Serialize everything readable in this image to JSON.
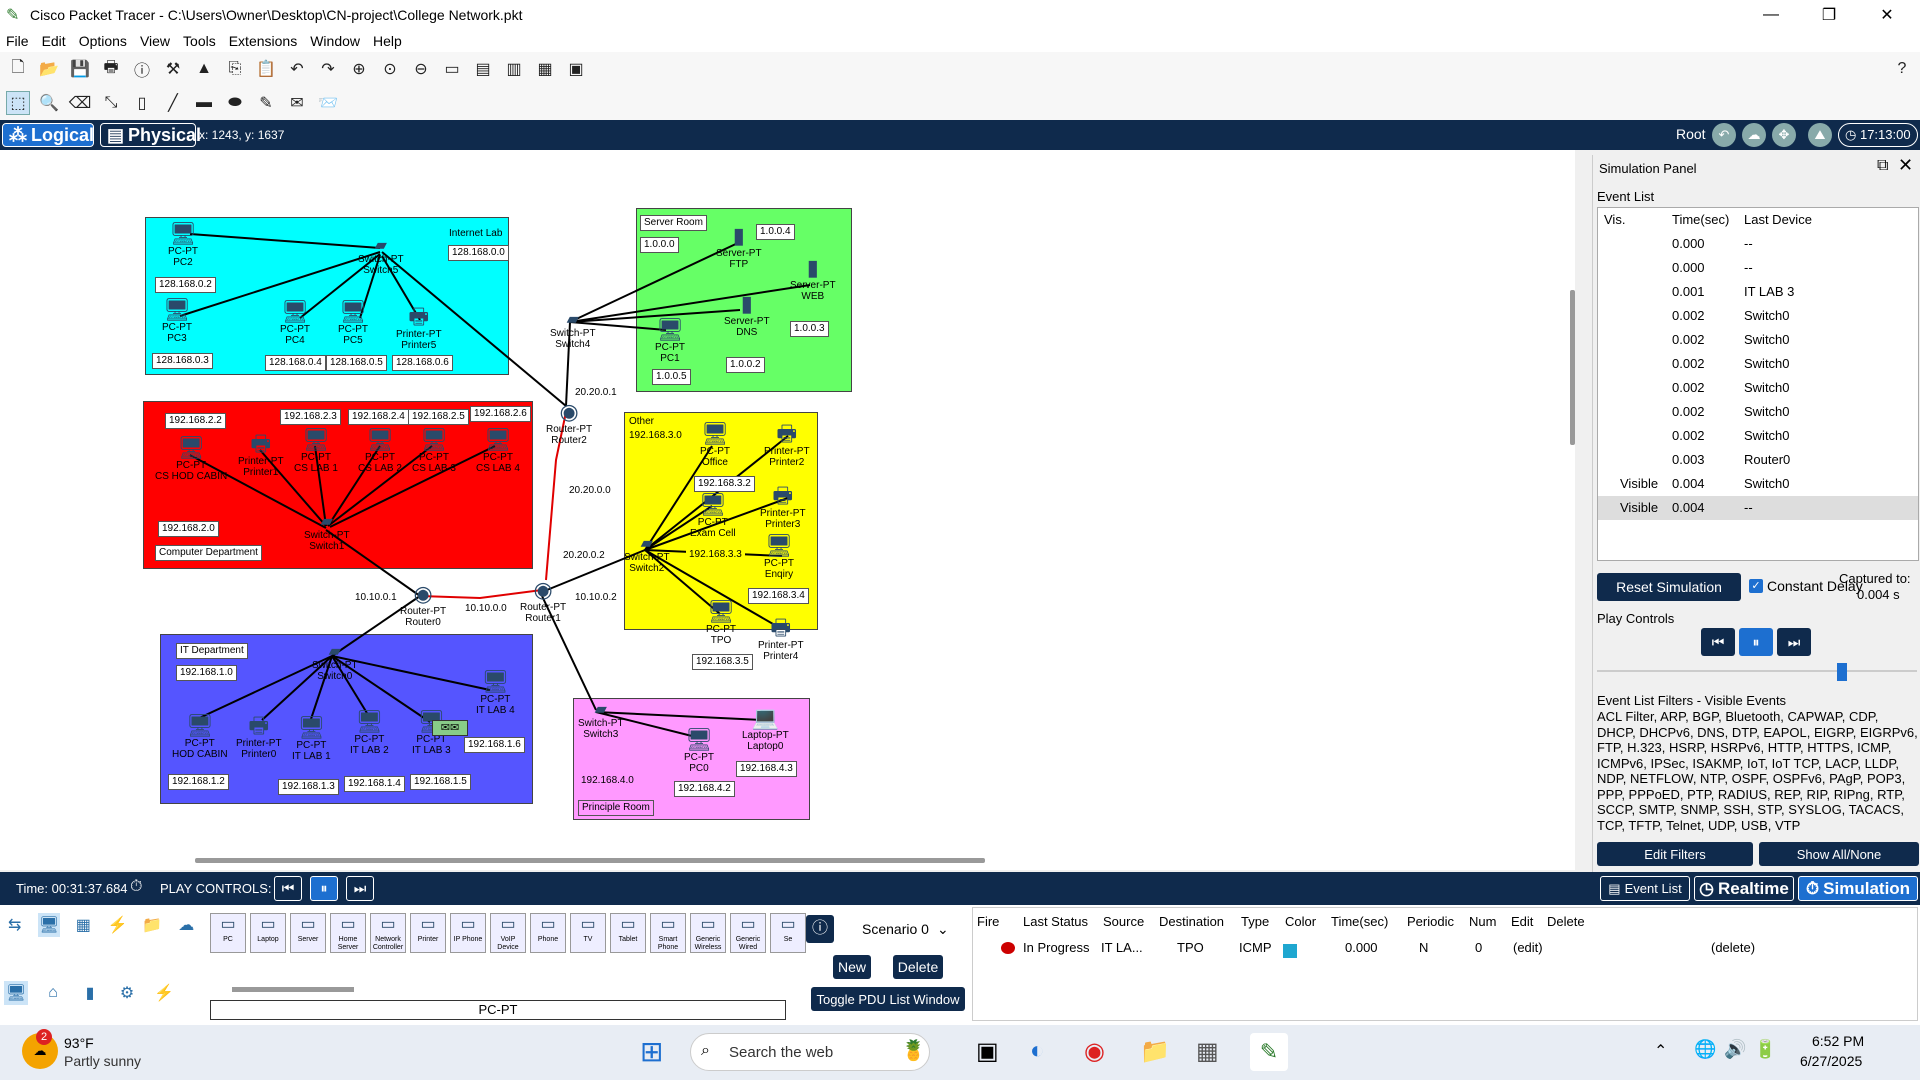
{
  "window": {
    "title": "Cisco Packet Tracer - C:\\Users\\Owner\\Desktop\\CN-project\\College Network.pkt"
  },
  "menu": [
    "File",
    "Edit",
    "Options",
    "View",
    "Tools",
    "Extensions",
    "Window",
    "Help"
  ],
  "modebar": {
    "logical": "Logical",
    "physical": "Physical",
    "coords": "x: 1243, y: 1637",
    "root": "Root",
    "clock": "17:13:00"
  },
  "zones": {
    "internet": {
      "title": "Internet Lab",
      "net": "128.168.0.0",
      "color": "#00ffff"
    },
    "server": {
      "title": "Server Room",
      "net": "1.0.0.0",
      "color": "#66ff66"
    },
    "cs": {
      "title": "Computer Department",
      "net": "192.168.2.0",
      "color": "#ff0000"
    },
    "other": {
      "title": "Other",
      "net": "192.168.3.0",
      "color": "#ffff00"
    },
    "it": {
      "title": "IT Department",
      "net": "192.168.1.0",
      "color": "#5555ff"
    },
    "principle": {
      "title": "Principle Room",
      "net": "192.168.4.0",
      "color": "#ff99ff"
    }
  },
  "devices": [
    {
      "id": "pc2",
      "type": "PC-PT",
      "name": "PC2",
      "ip": "128.168.0.2"
    },
    {
      "id": "pc3",
      "type": "PC-PT",
      "name": "PC3",
      "ip": "128.168.0.3"
    },
    {
      "id": "pc4",
      "type": "PC-PT",
      "name": "PC4",
      "ip": "128.168.0.4"
    },
    {
      "id": "pc5",
      "type": "PC-PT",
      "name": "PC5",
      "ip": "128.168.0.5"
    },
    {
      "id": "printer5",
      "type": "Printer-PT",
      "name": "Printer5",
      "ip": "128.168.0.6"
    },
    {
      "id": "switch5",
      "type": "Switch-PT",
      "name": "Switch5",
      "ip": ""
    },
    {
      "id": "ftp",
      "type": "Server-PT",
      "name": "FTP",
      "ip": "1.0.0.4"
    },
    {
      "id": "web",
      "type": "Server-PT",
      "name": "WEB",
      "ip": "1.0.0.3"
    },
    {
      "id": "dns",
      "type": "Server-PT",
      "name": "DNS",
      "ip": "1.0.0.2"
    },
    {
      "id": "pc1",
      "type": "PC-PT",
      "name": "PC1",
      "ip": "1.0.0.5"
    },
    {
      "id": "switch4",
      "type": "Switch-PT",
      "name": "Switch4",
      "ip": ""
    },
    {
      "id": "router2",
      "type": "Router-PT",
      "name": "Router2",
      "ip": "20.20.0.1"
    },
    {
      "id": "cshod",
      "type": "PC-PT",
      "name": "CS HOD CABIN",
      "ip": "192.168.2.2"
    },
    {
      "id": "printer1",
      "type": "Printer-PT",
      "name": "Printer1",
      "ip": "192.168.2.3"
    },
    {
      "id": "cslab1",
      "type": "PC-PT",
      "name": "CS LAB 1",
      "ip": "192.168.2.4"
    },
    {
      "id": "cslab2",
      "type": "PC-PT",
      "name": "CS LAB 2",
      "ip": "192.168.2.5"
    },
    {
      "id": "cslab3",
      "type": "PC-PT",
      "name": "CS LAB 3",
      "ip": "192.168.2.6"
    },
    {
      "id": "cslab4",
      "type": "PC-PT",
      "name": "CS LAB 4",
      "ip": ""
    },
    {
      "id": "switch1",
      "type": "Switch-PT",
      "name": "Switch1",
      "ip": ""
    },
    {
      "id": "office",
      "type": "PC-PT",
      "name": "Office",
      "ip": "192.168.3.2"
    },
    {
      "id": "printer2",
      "type": "Printer-PT",
      "name": "Printer2",
      "ip": ""
    },
    {
      "id": "examcell",
      "type": "PC-PT",
      "name": "Exam Cell",
      "ip": "192.168.3.3"
    },
    {
      "id": "printer3",
      "type": "Printer-PT",
      "name": "Printer3",
      "ip": ""
    },
    {
      "id": "enqiry",
      "type": "PC-PT",
      "name": "Enqiry",
      "ip": "192.168.3.4"
    },
    {
      "id": "tpo",
      "type": "PC-PT",
      "name": "TPO",
      "ip": "192.168.3.5"
    },
    {
      "id": "printer4",
      "type": "Printer-PT",
      "name": "Printer4",
      "ip": ""
    },
    {
      "id": "switch2",
      "type": "Switch-PT",
      "name": "Switch2",
      "ip": "20.20.0.2"
    },
    {
      "id": "router0",
      "type": "Router-PT",
      "name": "Router0",
      "ip": "10.10.0.1"
    },
    {
      "id": "router1",
      "type": "Router-PT",
      "name": "Router1",
      "ip": "10.10.0.2"
    },
    {
      "id": "ithod",
      "type": "PC-PT",
      "name": "HOD CABIN",
      "ip": "192.168.1.2"
    },
    {
      "id": "printer0",
      "type": "Printer-PT",
      "name": "Printer0",
      "ip": ""
    },
    {
      "id": "itlab1",
      "type": "PC-PT",
      "name": "IT LAB 1",
      "ip": "192.168.1.3"
    },
    {
      "id": "itlab2",
      "type": "PC-PT",
      "name": "IT LAB 2",
      "ip": "192.168.1.4"
    },
    {
      "id": "itlab3",
      "type": "PC-PT",
      "name": "IT LAB 3",
      "ip": "192.168.1.5"
    },
    {
      "id": "itlab4",
      "type": "PC-PT",
      "name": "IT LAB 4",
      "ip": "192.168.1.6"
    },
    {
      "id": "switch0",
      "type": "Switch-PT",
      "name": "Switch0",
      "ip": ""
    },
    {
      "id": "switch3",
      "type": "Switch-PT",
      "name": "Switch3",
      "ip": ""
    },
    {
      "id": "pc0",
      "type": "PC-PT",
      "name": "PC0",
      "ip": "192.168.4.2"
    },
    {
      "id": "laptop0",
      "type": "Laptop-PT",
      "name": "Laptop0",
      "ip": "192.168.4.3"
    }
  ],
  "extra_labels": {
    "l10100": "10.10.0.0",
    "l20200": "20.20.0.0"
  },
  "sim": {
    "title": "Simulation Panel",
    "event_list": "Event List",
    "headers": [
      "Vis.",
      "Time(sec)",
      "Last Device"
    ],
    "events": [
      {
        "vis": "",
        "time": "0.000",
        "dev": "--"
      },
      {
        "vis": "",
        "time": "0.000",
        "dev": "--"
      },
      {
        "vis": "",
        "time": "0.001",
        "dev": "IT LAB 3"
      },
      {
        "vis": "",
        "time": "0.002",
        "dev": "Switch0"
      },
      {
        "vis": "",
        "time": "0.002",
        "dev": "Switch0"
      },
      {
        "vis": "",
        "time": "0.002",
        "dev": "Switch0"
      },
      {
        "vis": "",
        "time": "0.002",
        "dev": "Switch0"
      },
      {
        "vis": "",
        "time": "0.002",
        "dev": "Switch0"
      },
      {
        "vis": "",
        "time": "0.002",
        "dev": "Switch0"
      },
      {
        "vis": "",
        "time": "0.003",
        "dev": "Router0"
      },
      {
        "vis": "Visible",
        "time": "0.004",
        "dev": "Switch0"
      },
      {
        "vis": "Visible",
        "time": "0.004",
        "dev": "--"
      }
    ],
    "reset": "Reset Simulation",
    "constant_delay": "Constant Delay",
    "captured_label": "Captured to:",
    "captured_value": "0.004 s",
    "play_controls": "Play Controls",
    "filters_title": "Event List Filters - Visible Events",
    "filters": "ACL Filter, ARP, BGP, Bluetooth, CAPWAP, CDP, DHCP, DHCPv6, DNS, DTP, EAPOL, EIGRP, EIGRPv6, FTP, H.323, HSRP, HSRPv6, HTTP, HTTPS, ICMP, ICMPv6, IPSec, ISAKMP, IoT, IoT TCP, LACP, LLDP, NDP, NETFLOW, NTP, OSPF, OSPFv6, PAgP, POP3, PPP, PPPoED, PTP, RADIUS, REP, RIP, RIPng, RTP, SCCP, SMTP, SNMP, SSH, STP, SYSLOG, TACACS, TCP, TFTP, Telnet, UDP, USB, VTP",
    "edit_filters": "Edit Filters",
    "show_all": "Show All/None"
  },
  "statusbar": {
    "time": "Time: 00:31:37.684",
    "play": "PLAY CONTROLS:",
    "event_list": "Event List",
    "realtime": "Realtime",
    "simulation": "Simulation"
  },
  "palette": {
    "items": [
      "PC",
      "Laptop",
      "Server",
      "Home Server",
      "Network Controller",
      "Printer",
      "IP Phone",
      "VoIP Device",
      "Phone",
      "TV",
      "Tablet",
      "Smart Phone",
      "Generic Wireless",
      "Generic Wired",
      "Se"
    ],
    "selected": "PC-PT"
  },
  "scenario": {
    "name": "Scenario 0",
    "new": "New",
    "delete": "Delete",
    "toggle": "Toggle PDU List Window"
  },
  "pdu": {
    "headers": [
      "Fire",
      "Last Status",
      "Source",
      "Destination",
      "Type",
      "Color",
      "Time(sec)",
      "Periodic",
      "Num",
      "Edit",
      "Delete"
    ],
    "row": {
      "status": "In Progress",
      "source": "IT LA...",
      "dest": "TPO",
      "type": "ICMP",
      "time": "0.000",
      "periodic": "N",
      "num": "0",
      "edit": "(edit)",
      "delete": "(delete)"
    }
  },
  "taskbar": {
    "temp": "93°F",
    "weather": "Partly sunny",
    "badge": "2",
    "search": "Search the web",
    "time": "6:52 PM",
    "date": "6/27/2025"
  }
}
